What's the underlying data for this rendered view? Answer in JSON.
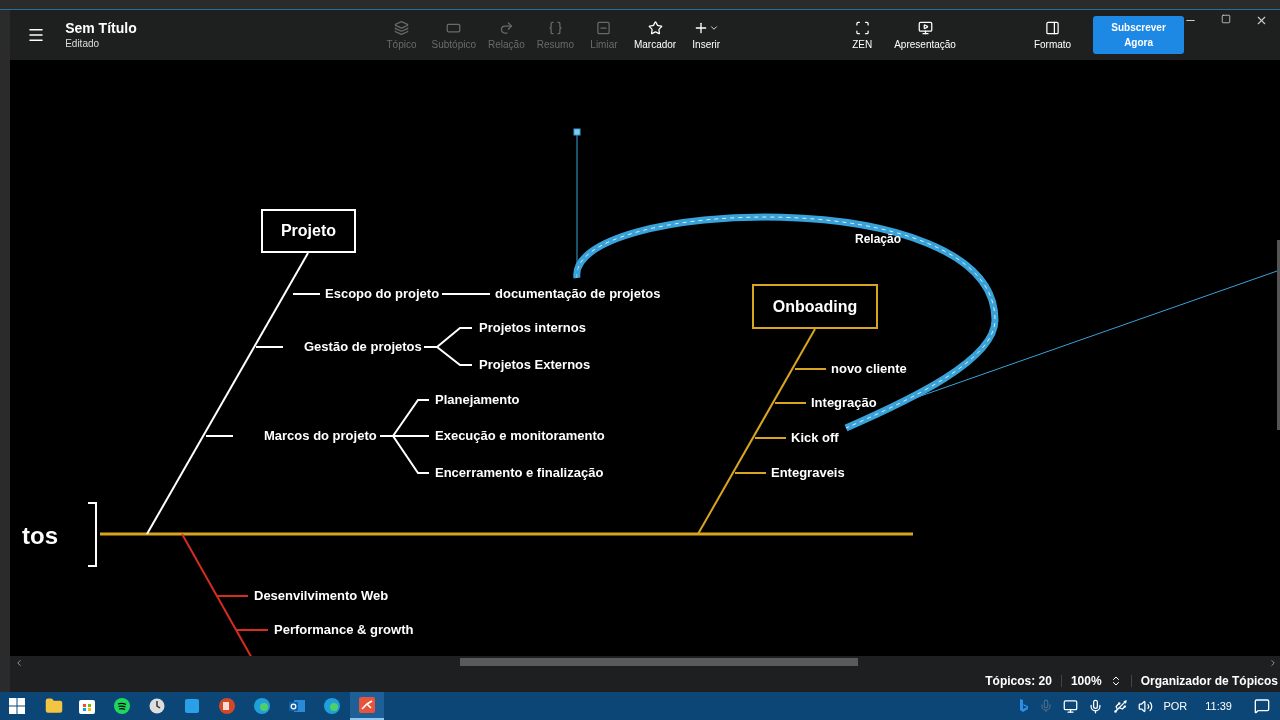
{
  "toolbar": {
    "title": "Sem Título",
    "subtitle": "Editado",
    "tools": [
      {
        "kind": "topic",
        "label": "Tópico",
        "disabled": true
      },
      {
        "kind": "subtopic",
        "label": "Subtópico",
        "disabled": true
      },
      {
        "kind": "relation",
        "label": "Relação",
        "disabled": true
      },
      {
        "kind": "summary",
        "label": "Resumo",
        "disabled": true
      },
      {
        "kind": "boundary",
        "label": "Limiar",
        "disabled": true
      },
      {
        "kind": "marker",
        "label": "Marcador",
        "disabled": false
      },
      {
        "kind": "insert",
        "label": "Inserir",
        "disabled": false
      }
    ],
    "view_tools": [
      {
        "kind": "zen",
        "label": "ZEN"
      },
      {
        "kind": "present",
        "label": "Apresentação"
      }
    ],
    "format": "Formato",
    "subscribe": "Subscrever Agora"
  },
  "diagram": {
    "central_topic": "tos",
    "branches": [
      {
        "title": "Projeto",
        "color": "#ffffff",
        "topics": [
          {
            "label": "Escopo do projeto",
            "children": [
              {
                "label": "documentação de projetos"
              }
            ]
          },
          {
            "label": "Gestão de projetos",
            "children": [
              {
                "label": "Projetos internos"
              },
              {
                "label": "Projetos Externos"
              }
            ]
          },
          {
            "label": "Marcos do projeto",
            "children": [
              {
                "label": "Planejamento"
              },
              {
                "label": "Execução e monitoramento"
              },
              {
                "label": "Encerramento e finalização"
              }
            ]
          }
        ]
      },
      {
        "title": "Onboading",
        "color": "#d9a521",
        "topics": [
          {
            "label": "novo cliente"
          },
          {
            "label": "Integração"
          },
          {
            "label": "Kick off"
          },
          {
            "label": "Entegraveis"
          }
        ]
      },
      {
        "color": "#d62d20",
        "topics": [
          {
            "label": "Desenvilvimento Web"
          },
          {
            "label": "Performance & growth"
          }
        ]
      }
    ],
    "relationship": {
      "label": "Relação",
      "selected": true
    }
  },
  "status_bar": {
    "topics": "Tópicos: 20",
    "zoom": "100%",
    "organizer": "Organizador de Tópicos"
  },
  "taskbar": {
    "language": "POR",
    "time": "11:39"
  }
}
